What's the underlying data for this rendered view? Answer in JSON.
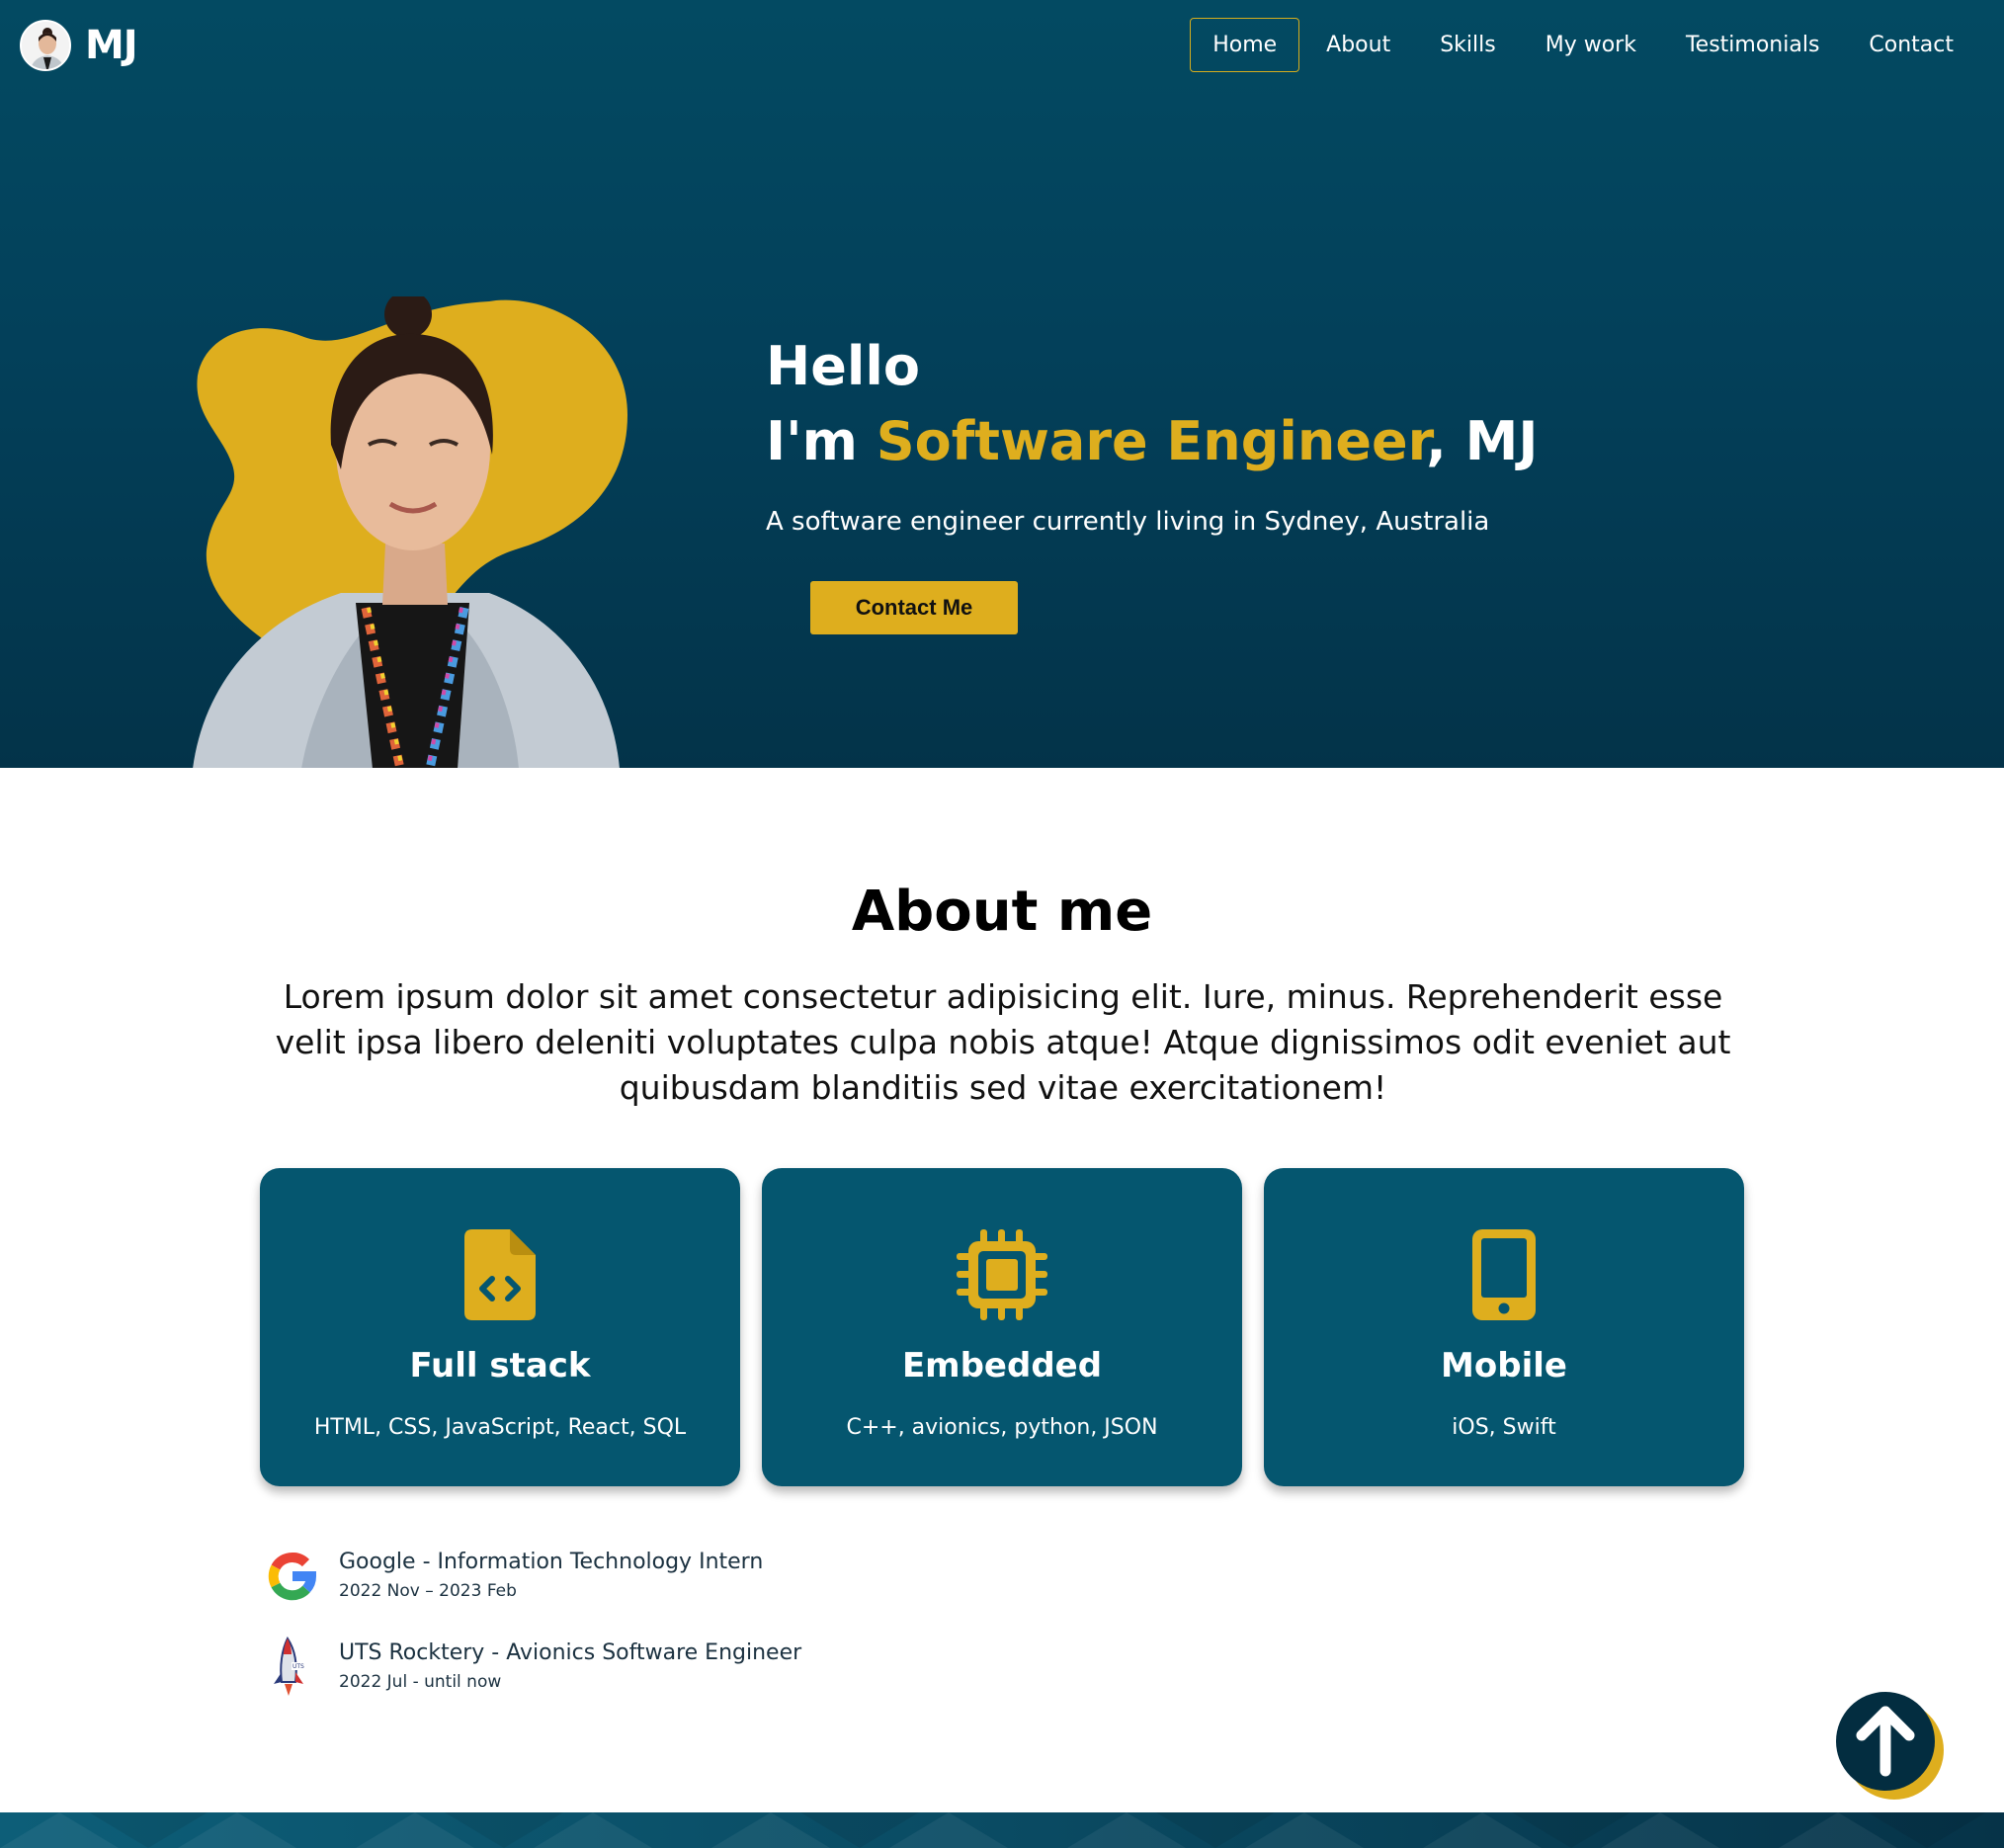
{
  "brand": {
    "name": "MJ"
  },
  "nav": {
    "items": [
      {
        "label": "Home",
        "active": true
      },
      {
        "label": "About"
      },
      {
        "label": "Skills"
      },
      {
        "label": "My work"
      },
      {
        "label": "Testimonials"
      },
      {
        "label": "Contact"
      }
    ]
  },
  "hero": {
    "greeting": "Hello",
    "intro_prefix": "I'm ",
    "intro_role": "Software Engineer",
    "intro_suffix": ", MJ",
    "subtitle": "A software engineer currently living in Sydney, Australia",
    "cta_label": "Contact Me"
  },
  "about": {
    "title": "About me",
    "body": "Lorem ipsum dolor sit amet consectetur adipisicing elit. Iure, minus. Reprehenderit esse velit ipsa libero deleniti voluptates culpa nobis atque! Atque dignissimos odit eveniet aut quibusdam blanditiis sed vitae exercitationem!"
  },
  "skills": [
    {
      "icon": "file-code-icon",
      "title": "Full stack",
      "desc": "HTML, CSS, JavaScript, React, SQL"
    },
    {
      "icon": "microchip-icon",
      "title": "Embedded",
      "desc": "C++, avionics, python, JSON"
    },
    {
      "icon": "mobile-phone-icon",
      "title": "Mobile",
      "desc": "iOS, Swift"
    }
  ],
  "experience": [
    {
      "logo": "google-logo-icon",
      "title": "Google - Information Technology Intern",
      "dates": "2022 Nov – 2023 Feb"
    },
    {
      "logo": "uts-rocketry-logo-icon",
      "title": "UTS Rocktery - Avionics Software Engineer",
      "dates": "2022 Jul - until now"
    }
  ],
  "scroll_top": {
    "icon": "arrow-up-icon"
  },
  "colors": {
    "primary_dark": "#034a62",
    "card_bg": "#05566f",
    "accent": "#deae1e",
    "scroll_btn": "#032d40"
  }
}
